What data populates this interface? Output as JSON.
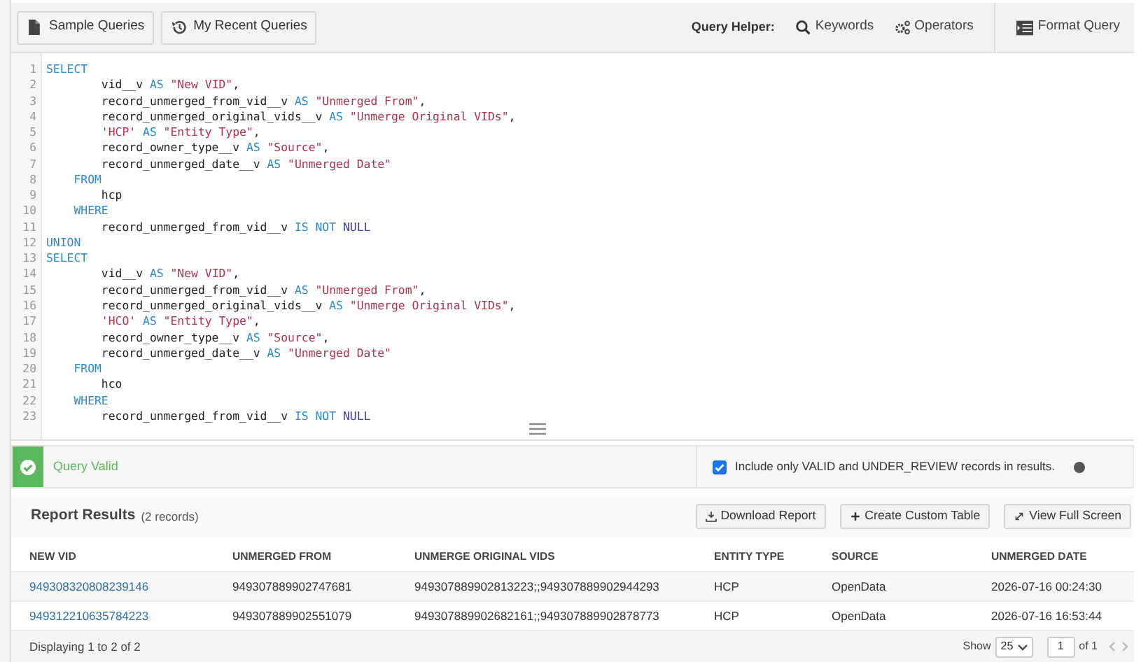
{
  "toolbar": {
    "buttons": [
      {
        "label": "Sample Queries",
        "kind": "document"
      },
      {
        "label": "My Recent Queries",
        "kind": "history"
      }
    ],
    "helper_label": "Query Helper:",
    "helper_buttons": [
      {
        "label": "Keywords",
        "kind": "search"
      },
      {
        "label": "Operators",
        "kind": "gears"
      }
    ],
    "format_button": "Format Query"
  },
  "editor": {
    "lines": [
      [
        {
          "text": "SELECT",
          "kind": "kw"
        }
      ],
      [
        {
          "text": "        vid__v ",
          "kind": "plain"
        },
        {
          "text": "AS",
          "kind": "kw"
        },
        {
          "text": " \"New VID\"",
          "kind": "str"
        },
        {
          "text": ",",
          "kind": "plain"
        }
      ],
      [
        {
          "text": "        record_unmerged_from_vid__v ",
          "kind": "plain"
        },
        {
          "text": "AS",
          "kind": "kw"
        },
        {
          "text": " \"Unmerged From\"",
          "kind": "str"
        },
        {
          "text": ",",
          "kind": "plain"
        }
      ],
      [
        {
          "text": "        record_unmerged_original_vids__v ",
          "kind": "plain"
        },
        {
          "text": "AS",
          "kind": "kw"
        },
        {
          "text": " \"Unmerge Original VIDs\"",
          "kind": "str"
        },
        {
          "text": ",",
          "kind": "plain"
        }
      ],
      [
        {
          "text": "        'HCP' ",
          "kind": "str"
        },
        {
          "text": "AS",
          "kind": "kw"
        },
        {
          "text": " \"Entity Type\"",
          "kind": "str"
        },
        {
          "text": ",",
          "kind": "plain"
        }
      ],
      [
        {
          "text": "        record_owner_type__v ",
          "kind": "plain"
        },
        {
          "text": "AS",
          "kind": "kw"
        },
        {
          "text": " \"Source\"",
          "kind": "str"
        },
        {
          "text": ",",
          "kind": "plain"
        }
      ],
      [
        {
          "text": "        record_unmerged_date__v ",
          "kind": "plain"
        },
        {
          "text": "AS",
          "kind": "kw"
        },
        {
          "text": " \"Unmerged Date\"",
          "kind": "str"
        }
      ],
      [
        {
          "text": "    FROM",
          "kind": "kw"
        }
      ],
      [
        {
          "text": "        hcp",
          "kind": "plain"
        }
      ],
      [
        {
          "text": "    WHERE",
          "kind": "kw"
        }
      ],
      [
        {
          "text": "        record_unmerged_from_vid__v ",
          "kind": "plain"
        },
        {
          "text": "IS NOT",
          "kind": "kw"
        },
        {
          "text": " NULL",
          "kind": "const"
        }
      ],
      [
        {
          "text": "UNION",
          "kind": "kw"
        }
      ],
      [
        {
          "text": "SELECT",
          "kind": "kw"
        }
      ],
      [
        {
          "text": "        vid__v ",
          "kind": "plain"
        },
        {
          "text": "AS",
          "kind": "kw"
        },
        {
          "text": " \"New VID\"",
          "kind": "str"
        },
        {
          "text": ",",
          "kind": "plain"
        }
      ],
      [
        {
          "text": "        record_unmerged_from_vid__v ",
          "kind": "plain"
        },
        {
          "text": "AS",
          "kind": "kw"
        },
        {
          "text": " \"Unmerged From\"",
          "kind": "str"
        },
        {
          "text": ",",
          "kind": "plain"
        }
      ],
      [
        {
          "text": "        record_unmerged_original_vids__v ",
          "kind": "plain"
        },
        {
          "text": "AS",
          "kind": "kw"
        },
        {
          "text": " \"Unmerge Original VIDs\"",
          "kind": "str"
        },
        {
          "text": ",",
          "kind": "plain"
        }
      ],
      [
        {
          "text": "        'HCO' ",
          "kind": "str"
        },
        {
          "text": "AS",
          "kind": "kw"
        },
        {
          "text": " \"Entity Type\"",
          "kind": "str"
        },
        {
          "text": ",",
          "kind": "plain"
        }
      ],
      [
        {
          "text": "        record_owner_type__v ",
          "kind": "plain"
        },
        {
          "text": "AS",
          "kind": "kw"
        },
        {
          "text": " \"Source\"",
          "kind": "str"
        },
        {
          "text": ",",
          "kind": "plain"
        }
      ],
      [
        {
          "text": "        record_unmerged_date__v ",
          "kind": "plain"
        },
        {
          "text": "AS",
          "kind": "kw"
        },
        {
          "text": " \"Unmerged Date\"",
          "kind": "str"
        }
      ],
      [
        {
          "text": "    FROM",
          "kind": "kw"
        }
      ],
      [
        {
          "text": "        hco",
          "kind": "plain"
        }
      ],
      [
        {
          "text": "    WHERE",
          "kind": "kw"
        }
      ],
      [
        {
          "text": "        record_unmerged_from_vid__v ",
          "kind": "plain"
        },
        {
          "text": "IS NOT",
          "kind": "kw"
        },
        {
          "text": " NULL",
          "kind": "const"
        }
      ]
    ],
    "line_numbers": [
      "1",
      "2",
      "3",
      "4",
      "5",
      "6",
      "7",
      "8",
      "9",
      "10",
      "11",
      "12",
      "13",
      "14",
      "15",
      "16",
      "17",
      "18",
      "19",
      "20",
      "21",
      "22",
      "23"
    ]
  },
  "status": {
    "valid": true,
    "message": "Query Valid",
    "filter": {
      "label": "Include only VALID and UNDER_REVIEW records in results.",
      "checked": true
    }
  },
  "results": {
    "title": "Report Results",
    "count": "(2 records)",
    "buttons": [
      {
        "label": "Download Report",
        "kind": "download"
      },
      {
        "label": "Create Custom Table",
        "kind": "plus"
      },
      {
        "label": "View Full Screen",
        "kind": "expand"
      }
    ],
    "columns": [
      "NEW VID",
      "UNMERGED FROM",
      "UNMERGE ORIGINAL VIDS",
      "ENTITY TYPE",
      "SOURCE",
      "UNMERGED DATE"
    ],
    "rows": [
      [
        "949308320808239146",
        "949307889902747681",
        "949307889902813223;;949307889902944293",
        "HCP",
        "OpenData",
        "2026-07-16 00:24:30"
      ],
      [
        "949312210635784223",
        "949307889902551079",
        "949307889902682161;;949307889902878773",
        "HCP",
        "OpenData",
        "2026-07-16 16:53:44"
      ]
    ],
    "footer": {
      "summary": "Displaying 1 to 2 of 2",
      "show_label": "Show",
      "page_size": "25",
      "page": "1",
      "page_total": "of 1"
    }
  }
}
